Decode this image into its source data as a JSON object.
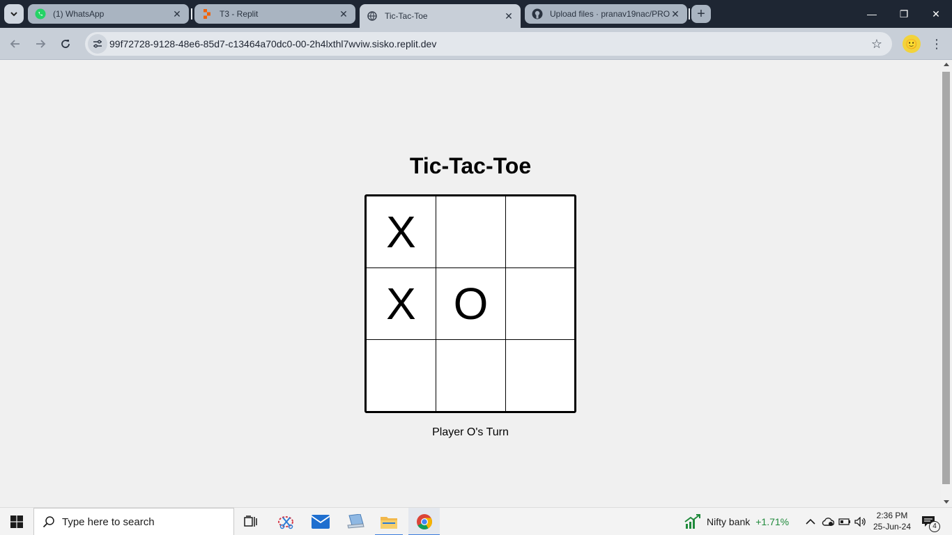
{
  "browser": {
    "tabs": [
      {
        "title": "(1) WhatsApp",
        "icon": "whatsapp-icon",
        "active": false
      },
      {
        "title": "T3 - Replit",
        "icon": "replit-icon",
        "active": false
      },
      {
        "title": "Tic-Tac-Toe",
        "icon": "globe-icon",
        "active": true
      },
      {
        "title": "Upload files · pranav19nac/PRO",
        "icon": "github-icon",
        "active": false
      }
    ],
    "url": "99f72728-9128-48e6-85d7-c13464a70dc0-00-2h4lxthl7wviw.sisko.replit.dev",
    "window_controls": {
      "minimize": "—",
      "restore": "❐",
      "close": "✕"
    }
  },
  "game": {
    "title": "Tic-Tac-Toe",
    "board": [
      [
        "X",
        "",
        ""
      ],
      [
        "X",
        "O",
        ""
      ],
      [
        "",
        "",
        ""
      ]
    ],
    "status": "Player O's Turn"
  },
  "taskbar": {
    "search_placeholder": "Type here to search",
    "apps": [
      "task-view-icon",
      "snipping-tool-icon",
      "mail-icon",
      "laptop-icon",
      "file-explorer-icon",
      "chrome-icon"
    ],
    "stock": {
      "name": "Nifty bank",
      "change": "+1.71%",
      "change_color": "#1f8a3b"
    },
    "time": "2:36 PM",
    "date": "25-Jun-24",
    "notification_count": "4"
  },
  "colors": {
    "tabstrip_bg": "#1e2633",
    "toolbar_bg": "#c8cfd8",
    "page_bg": "#f0f0f0"
  }
}
